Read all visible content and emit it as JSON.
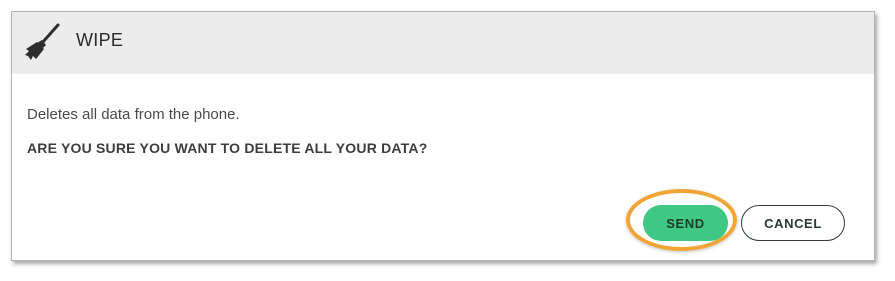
{
  "dialog": {
    "title": "WIPE",
    "icon": "broom-icon",
    "description": "Deletes all data from the phone.",
    "warning": "ARE YOU SURE YOU WANT TO DELETE ALL YOUR DATA?",
    "buttons": {
      "send_label": "SEND",
      "cancel_label": "CANCEL"
    },
    "colors": {
      "send_background": "#3fc883",
      "highlight_ring": "#f0a535",
      "header_background": "#ececec"
    }
  }
}
